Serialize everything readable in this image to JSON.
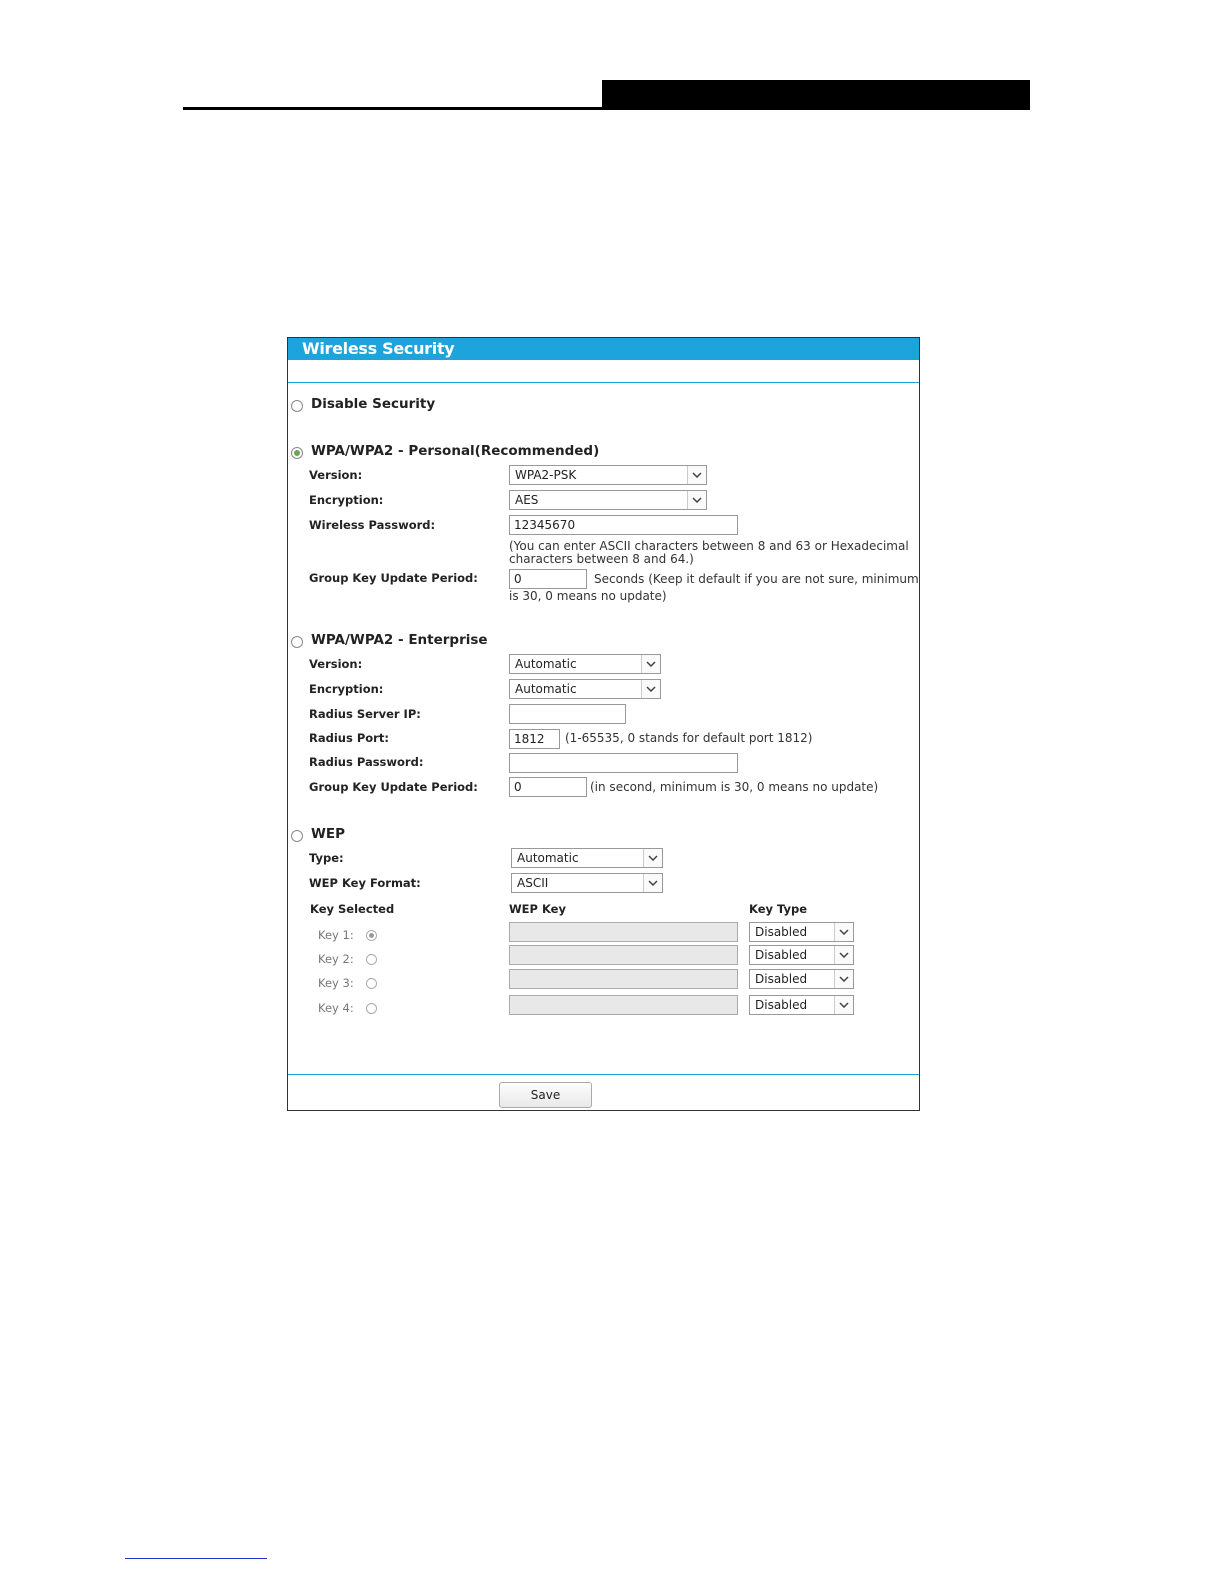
{
  "panel": {
    "title": "Wireless Security",
    "save_label": "Save"
  },
  "disable_security": {
    "label": "Disable Security",
    "selected": false
  },
  "wpa_personal": {
    "title": "WPA/WPA2 - Personal(Recommended)",
    "selected": true,
    "version_label": "Version:",
    "version_value": "WPA2-PSK",
    "encryption_label": "Encryption:",
    "encryption_value": "AES",
    "password_label": "Wireless Password:",
    "password_value": "12345670",
    "password_note_line1": "(You can enter ASCII characters between 8 and 63 or Hexadecimal",
    "password_note_line2": "characters between 8 and 64.)",
    "group_key_label": "Group Key Update Period:",
    "group_key_value": "0",
    "group_key_note_line1": "Seconds (Keep it default if you are not sure, minimum",
    "group_key_note_line2": "is 30, 0 means no update)"
  },
  "wpa_enterprise": {
    "title": "WPA/WPA2 - Enterprise",
    "selected": false,
    "version_label": "Version:",
    "version_value": "Automatic",
    "encryption_label": "Encryption:",
    "encryption_value": "Automatic",
    "radius_ip_label": "Radius Server IP:",
    "radius_ip_value": "",
    "radius_port_label": "Radius Port:",
    "radius_port_value": "1812",
    "radius_port_note": "(1-65535, 0 stands for default port 1812)",
    "radius_password_label": "Radius Password:",
    "radius_password_value": "",
    "group_key_label": "Group Key Update Period:",
    "group_key_value": "0",
    "group_key_note": "(in second, minimum is 30, 0 means no update)"
  },
  "wep": {
    "title": "WEP",
    "selected": false,
    "type_label": "Type:",
    "type_value": "Automatic",
    "format_label": "WEP Key Format:",
    "format_value": "ASCII",
    "col_key_selected": "Key Selected",
    "col_wep_key": "WEP Key",
    "col_key_type": "Key Type",
    "keys": [
      {
        "label": "Key 1:",
        "selected": true,
        "value": "",
        "type": "Disabled"
      },
      {
        "label": "Key 2:",
        "selected": false,
        "value": "",
        "type": "Disabled"
      },
      {
        "label": "Key 3:",
        "selected": false,
        "value": "",
        "type": "Disabled"
      },
      {
        "label": "Key 4:",
        "selected": false,
        "value": "",
        "type": "Disabled"
      }
    ]
  },
  "icons": {
    "dropdown": "chevron-down-icon",
    "radio": "radio-button"
  },
  "colors": {
    "title_bar": "#1ea4dd",
    "radio_selected": "#6aa84f"
  }
}
